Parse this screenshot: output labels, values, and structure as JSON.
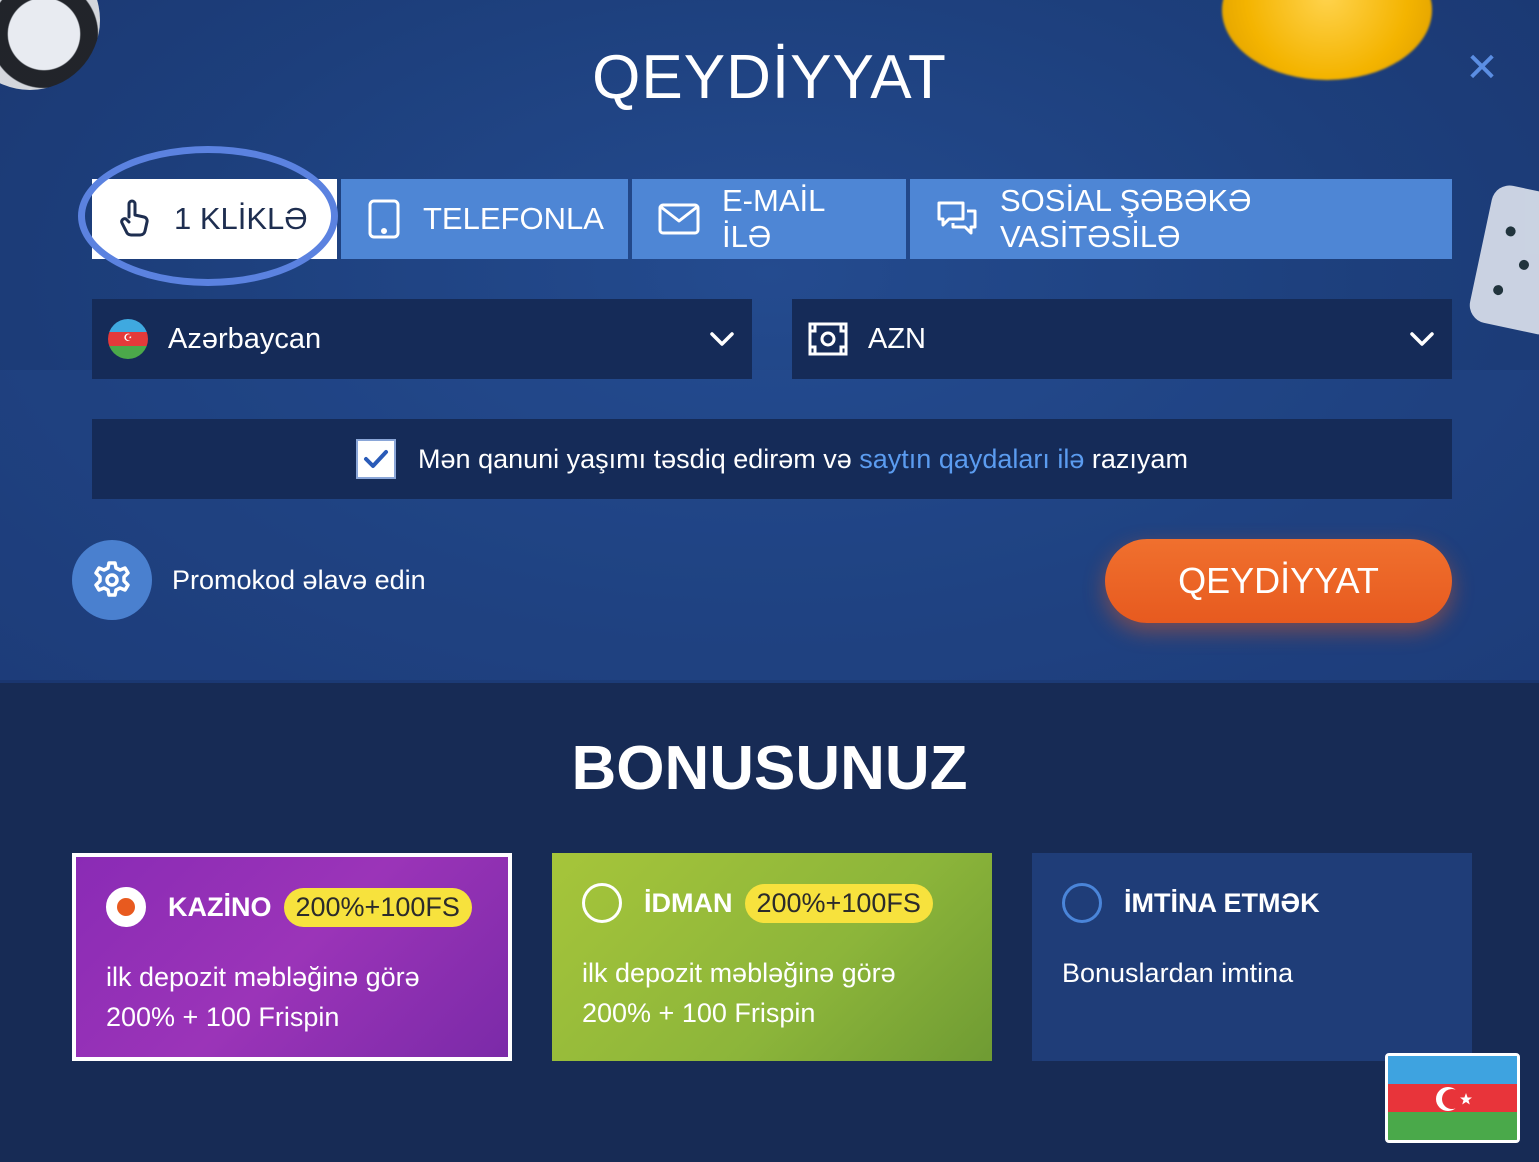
{
  "title": "QEYDİYYAT",
  "tabs": [
    {
      "label": "1 KLİKLƏ",
      "icon": "hand-pointer-icon",
      "active": true
    },
    {
      "label": "TELEFONLA",
      "icon": "phone-icon",
      "active": false
    },
    {
      "label": "E-MAİL İLƏ",
      "icon": "envelope-icon",
      "active": false
    },
    {
      "label": "SOSİAL ŞƏBƏKƏ VASİTƏSİLƏ",
      "icon": "chat-bubbles-icon",
      "active": false
    }
  ],
  "country": {
    "value": "Azərbaycan",
    "icon": "azerbaijan-flag-icon"
  },
  "currency": {
    "value": "AZN",
    "icon": "banknote-icon"
  },
  "agreement": {
    "checked": true,
    "text_before": "Mən qanuni yaşımı təsdiq edirəm və",
    "link": "saytın qaydaları ilə",
    "text_after": "razıyam"
  },
  "promo": {
    "label": "Promokod əlavə edin",
    "icon": "gear-icon"
  },
  "register_button": "QEYDİYYAT",
  "bonus_title": "BONUSUNUZ",
  "bonuses": [
    {
      "name": "KAZİNO",
      "badge": "200%+100FS",
      "line1": "ilk depozit məbləğinə görə",
      "line2": "200% + 100 Frispin",
      "selected": true
    },
    {
      "name": "İDMAN",
      "badge": "200%+100FS",
      "line1": "ilk depozit məbləğinə görə",
      "line2": "200% + 100 Frispin",
      "selected": false
    },
    {
      "name": "İMTİNA ETMƏK",
      "line1": "Bonuslardan imtina",
      "selected": false
    }
  ],
  "colors": {
    "accent_orange": "#e8621f",
    "tab_blue": "#4e86d5",
    "link_blue": "#5b9cf0",
    "badge_yellow": "#f7e23d"
  }
}
